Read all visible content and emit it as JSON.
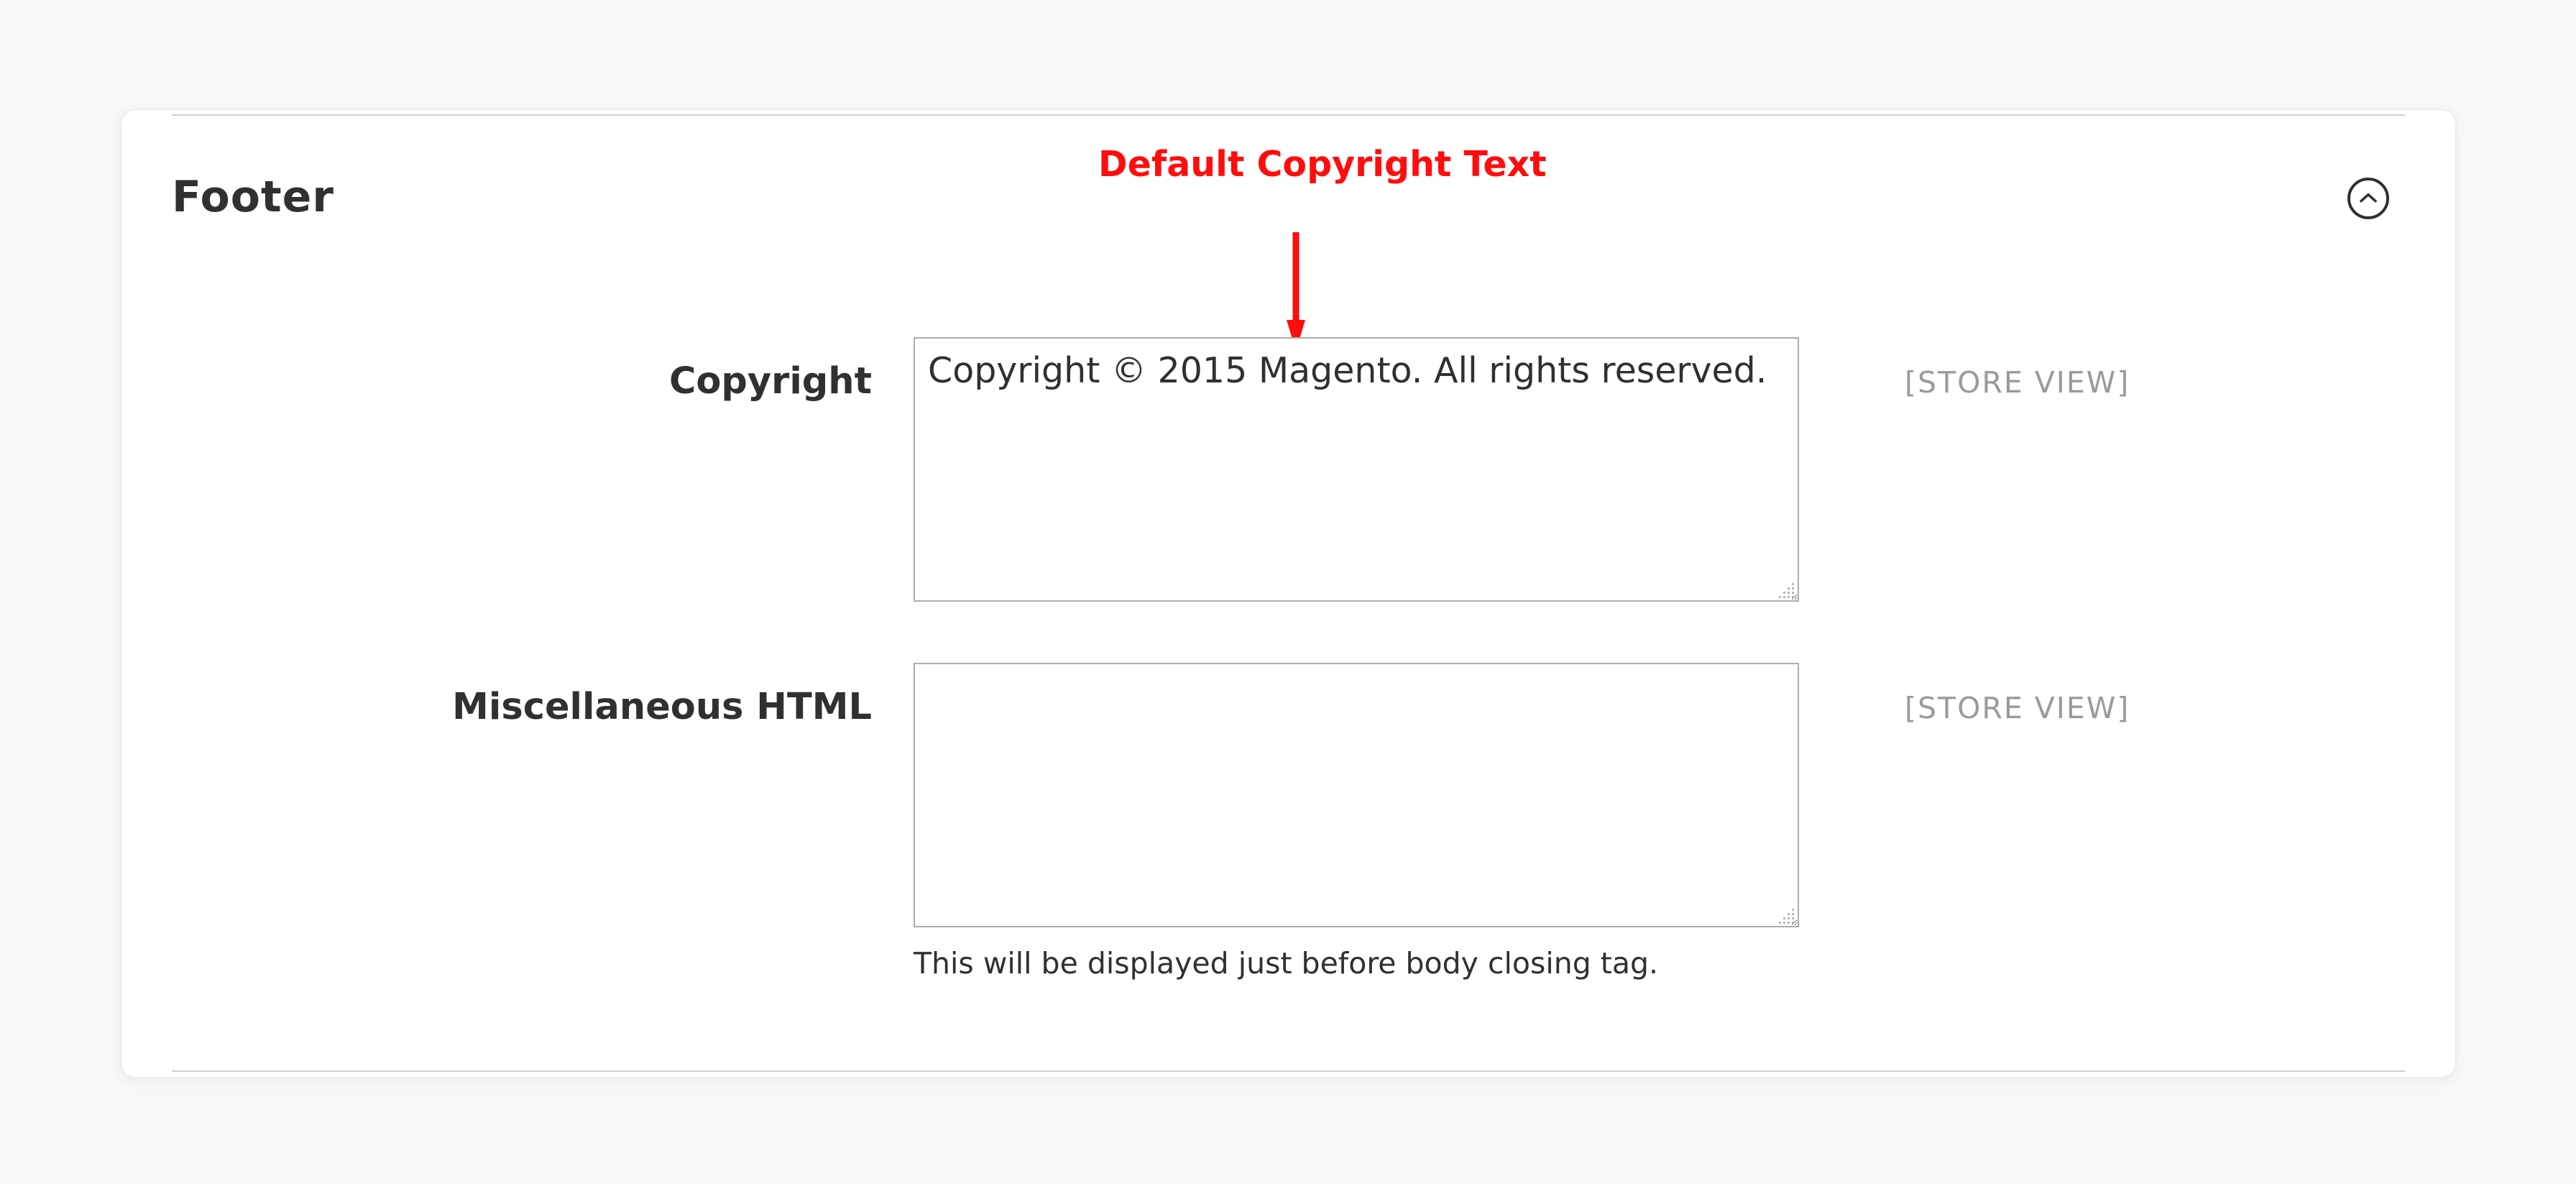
{
  "section": {
    "title": "Footer",
    "toggle_icon": "chevron-up-circle-icon"
  },
  "annotation": {
    "text": "Default Copyright Text",
    "color": "#ff0d0d"
  },
  "fields": {
    "copyright": {
      "label": "Copyright",
      "value": "Copyright © 2015 Magento. All rights reserved.",
      "scope": "[STORE VIEW]"
    },
    "misc_html": {
      "label": "Miscellaneous HTML",
      "value": "",
      "scope": "[STORE VIEW]",
      "note": "This will be displayed just before body closing tag."
    }
  }
}
